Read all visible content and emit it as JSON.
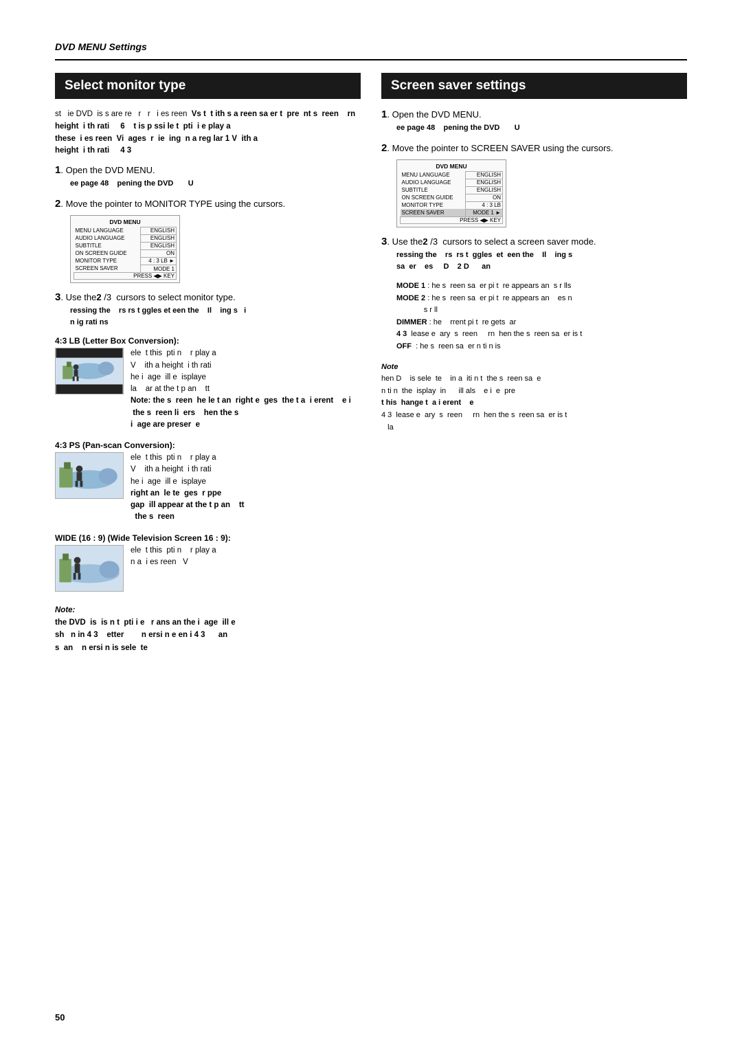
{
  "page": {
    "section_title": "DVD MENU Settings",
    "page_number": "50",
    "left_section": {
      "header": "Select monitor type",
      "intro_lines": [
        "st   ie DVD  is s are re   r  r  i es reen  Vs t  t ith s a reen sa er t  pre  nt s  reen    rn",
        "height  i th rati    6   t is p ssi le t  pti  i e play a",
        "these  i es reen  Vi  ages  r  ie  ing  n a reg lar 1 V  ith a",
        "height  i th rati    4 3"
      ],
      "steps": [
        {
          "num": "1",
          "text": "Open the DVD MENU.",
          "subnote": "ee page 48   pening the DVD      U"
        },
        {
          "num": "2",
          "text": "Move the pointer to MONITOR TYPE using the cursors.",
          "subnote": ""
        },
        {
          "num": "3",
          "text": "Use the 2 /3  cursors to select monitor type.",
          "subnote": "ressing the    rs  rs t  ggles  et  een the   Il   ing s  i\nn ig rati ns"
        }
      ],
      "dvd_menu": {
        "title": "DVD MENU",
        "rows": [
          {
            "label": "MENU LANGUAGE",
            "value": "ENGLISH"
          },
          {
            "label": "AUDIO LANGUAGE",
            "value": "ENGLISH"
          },
          {
            "label": "SUBTITLE",
            "value": "ENGLISH"
          },
          {
            "label": "ON SCREEN GUIDE",
            "value": "ON"
          },
          {
            "label": "MONITOR TYPE",
            "value": "4 : 3 LB"
          },
          {
            "label": "SCREEN SAVER",
            "value": "MODE 1"
          },
          {
            "label": "PRESS ◄► KEY",
            "value": ""
          }
        ]
      },
      "options": [
        {
          "label": "4:3 LB (Letter Box Conversion):",
          "lines": [
            "ele  t this  pti n   r play a",
            "V   ith a height  i th rati",
            "he i  age  ill e  isplaye",
            "la   ar at the t p an   tt"
          ],
          "note_line": "Note: the s  reen  he le t an  right e  ges  the t a  i erent   e i  the s  reen li  ers   hen the s  i  age are preser  e"
        },
        {
          "label": "4:3 PS (Pan-scan Conversion):",
          "lines": [
            "ele  t this  pti n   r play a",
            "V   ith a height  i th rati",
            "he i  age  ill e  isplaye",
            "right an  le te  ges  r ppe",
            "gap  ill appear at the t p an   tt",
            "  the s  reen"
          ]
        },
        {
          "label": "WIDE (16 : 9) (Wide Television Screen 16 : 9):",
          "lines": [
            "ele  t this  pti n   r play a",
            "n a  i es reen  V"
          ]
        }
      ],
      "note": {
        "italic_label": "Note:",
        "lines": [
          "the DVD  is  is n t  pti i e  r ans an the i  age  ill e",
          "sh   n in 4 3   etter      n ersi n e en i 4 3    an",
          "s  an   n ersi n is sele  te"
        ]
      }
    },
    "right_section": {
      "header": "Screen saver settings",
      "intro_lines": [
        "Open the DVD MENU.",
        "ee page 48   pening the DVD      U"
      ],
      "steps": [
        {
          "num": "1",
          "text": "Open the DVD MENU.",
          "subnote": "ee page 48   pening the DVD      U"
        },
        {
          "num": "2",
          "text": "Move the pointer to SCREEN SAVER using the cursors."
        },
        {
          "num": "3",
          "text": "Use the 2 /3  cursors to select a screen saver mode.",
          "subnote": "ressing the    rs  rs t  ggles  et  een the   Il   ing s\nsa  er   es    D   2  D    an"
        }
      ],
      "dvd_menu": {
        "title": "DVD MENU",
        "rows": [
          {
            "label": "MENU LANGUAGE",
            "value": "ENGLISH"
          },
          {
            "label": "AUDIO LANGUAGE",
            "value": "ENGLISH"
          },
          {
            "label": "SUBTITLE",
            "value": "ENGLISH"
          },
          {
            "label": "ON SCREEN GUIDE",
            "value": "ON"
          },
          {
            "label": "MONITOR TYPE",
            "value": "4 : 3 LB"
          },
          {
            "label": "SCREEN SAVER",
            "value": "MODE 1"
          },
          {
            "label": "PRESS ◄► KEY",
            "value": ""
          }
        ]
      },
      "modes": [
        {
          "label": "MODE 1",
          "desc": "he s  reen sa  er pi t  re appears an  s r lls"
        },
        {
          "label": "MODE 2",
          "desc": "he s  reen sa  er pi t  re appears an   es n\ns r ll"
        },
        {
          "label": "DIMMER",
          "desc": "he   rrent pi t  re gets  ar"
        },
        {
          "label": "OFF",
          "desc": "he s  reen sa  er n ti n is"
        }
      ],
      "note_lines": [
        "4 3  lease e  ary  s  reen    rn  hen the s  reen sa  er is t",
        "la",
        "hen D    is sele  te   in a  iti n t  the s  reen sa  e",
        "n ti n  the  isplay  in    ill als   e i  e  pre",
        "t his  hange t  a i erent   e",
        "t his  hange t  a i erent   e",
        "4 3  lease e  ary  s  reen    rn  hen the s  reen sa  er is t",
        "   la"
      ]
    }
  }
}
